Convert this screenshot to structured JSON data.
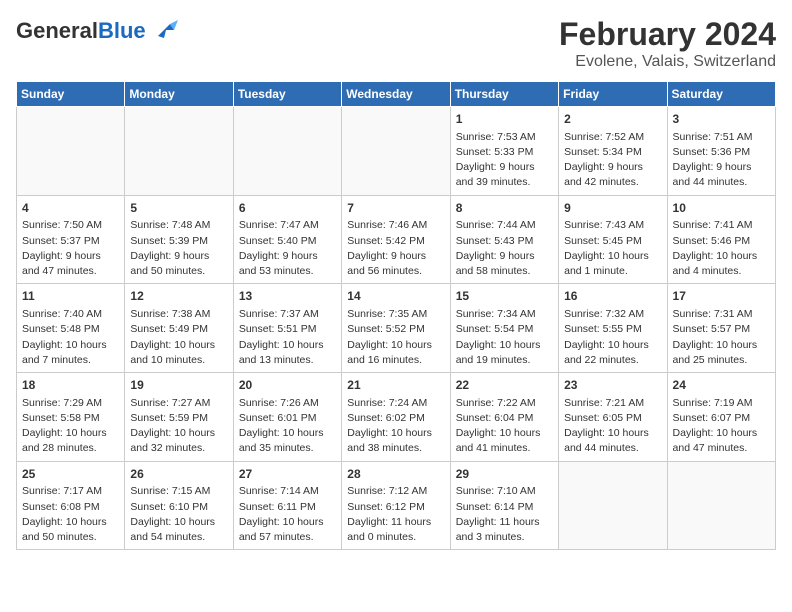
{
  "header": {
    "logo_general": "General",
    "logo_blue": "Blue",
    "title": "February 2024",
    "subtitle": "Evolene, Valais, Switzerland"
  },
  "weekdays": [
    "Sunday",
    "Monday",
    "Tuesday",
    "Wednesday",
    "Thursday",
    "Friday",
    "Saturday"
  ],
  "weeks": [
    [
      {
        "day": "",
        "info": ""
      },
      {
        "day": "",
        "info": ""
      },
      {
        "day": "",
        "info": ""
      },
      {
        "day": "",
        "info": ""
      },
      {
        "day": "1",
        "info": "Sunrise: 7:53 AM\nSunset: 5:33 PM\nDaylight: 9 hours\nand 39 minutes."
      },
      {
        "day": "2",
        "info": "Sunrise: 7:52 AM\nSunset: 5:34 PM\nDaylight: 9 hours\nand 42 minutes."
      },
      {
        "day": "3",
        "info": "Sunrise: 7:51 AM\nSunset: 5:36 PM\nDaylight: 9 hours\nand 44 minutes."
      }
    ],
    [
      {
        "day": "4",
        "info": "Sunrise: 7:50 AM\nSunset: 5:37 PM\nDaylight: 9 hours\nand 47 minutes."
      },
      {
        "day": "5",
        "info": "Sunrise: 7:48 AM\nSunset: 5:39 PM\nDaylight: 9 hours\nand 50 minutes."
      },
      {
        "day": "6",
        "info": "Sunrise: 7:47 AM\nSunset: 5:40 PM\nDaylight: 9 hours\nand 53 minutes."
      },
      {
        "day": "7",
        "info": "Sunrise: 7:46 AM\nSunset: 5:42 PM\nDaylight: 9 hours\nand 56 minutes."
      },
      {
        "day": "8",
        "info": "Sunrise: 7:44 AM\nSunset: 5:43 PM\nDaylight: 9 hours\nand 58 minutes."
      },
      {
        "day": "9",
        "info": "Sunrise: 7:43 AM\nSunset: 5:45 PM\nDaylight: 10 hours\nand 1 minute."
      },
      {
        "day": "10",
        "info": "Sunrise: 7:41 AM\nSunset: 5:46 PM\nDaylight: 10 hours\nand 4 minutes."
      }
    ],
    [
      {
        "day": "11",
        "info": "Sunrise: 7:40 AM\nSunset: 5:48 PM\nDaylight: 10 hours\nand 7 minutes."
      },
      {
        "day": "12",
        "info": "Sunrise: 7:38 AM\nSunset: 5:49 PM\nDaylight: 10 hours\nand 10 minutes."
      },
      {
        "day": "13",
        "info": "Sunrise: 7:37 AM\nSunset: 5:51 PM\nDaylight: 10 hours\nand 13 minutes."
      },
      {
        "day": "14",
        "info": "Sunrise: 7:35 AM\nSunset: 5:52 PM\nDaylight: 10 hours\nand 16 minutes."
      },
      {
        "day": "15",
        "info": "Sunrise: 7:34 AM\nSunset: 5:54 PM\nDaylight: 10 hours\nand 19 minutes."
      },
      {
        "day": "16",
        "info": "Sunrise: 7:32 AM\nSunset: 5:55 PM\nDaylight: 10 hours\nand 22 minutes."
      },
      {
        "day": "17",
        "info": "Sunrise: 7:31 AM\nSunset: 5:57 PM\nDaylight: 10 hours\nand 25 minutes."
      }
    ],
    [
      {
        "day": "18",
        "info": "Sunrise: 7:29 AM\nSunset: 5:58 PM\nDaylight: 10 hours\nand 28 minutes."
      },
      {
        "day": "19",
        "info": "Sunrise: 7:27 AM\nSunset: 5:59 PM\nDaylight: 10 hours\nand 32 minutes."
      },
      {
        "day": "20",
        "info": "Sunrise: 7:26 AM\nSunset: 6:01 PM\nDaylight: 10 hours\nand 35 minutes."
      },
      {
        "day": "21",
        "info": "Sunrise: 7:24 AM\nSunset: 6:02 PM\nDaylight: 10 hours\nand 38 minutes."
      },
      {
        "day": "22",
        "info": "Sunrise: 7:22 AM\nSunset: 6:04 PM\nDaylight: 10 hours\nand 41 minutes."
      },
      {
        "day": "23",
        "info": "Sunrise: 7:21 AM\nSunset: 6:05 PM\nDaylight: 10 hours\nand 44 minutes."
      },
      {
        "day": "24",
        "info": "Sunrise: 7:19 AM\nSunset: 6:07 PM\nDaylight: 10 hours\nand 47 minutes."
      }
    ],
    [
      {
        "day": "25",
        "info": "Sunrise: 7:17 AM\nSunset: 6:08 PM\nDaylight: 10 hours\nand 50 minutes."
      },
      {
        "day": "26",
        "info": "Sunrise: 7:15 AM\nSunset: 6:10 PM\nDaylight: 10 hours\nand 54 minutes."
      },
      {
        "day": "27",
        "info": "Sunrise: 7:14 AM\nSunset: 6:11 PM\nDaylight: 10 hours\nand 57 minutes."
      },
      {
        "day": "28",
        "info": "Sunrise: 7:12 AM\nSunset: 6:12 PM\nDaylight: 11 hours\nand 0 minutes."
      },
      {
        "day": "29",
        "info": "Sunrise: 7:10 AM\nSunset: 6:14 PM\nDaylight: 11 hours\nand 3 minutes."
      },
      {
        "day": "",
        "info": ""
      },
      {
        "day": "",
        "info": ""
      }
    ]
  ]
}
